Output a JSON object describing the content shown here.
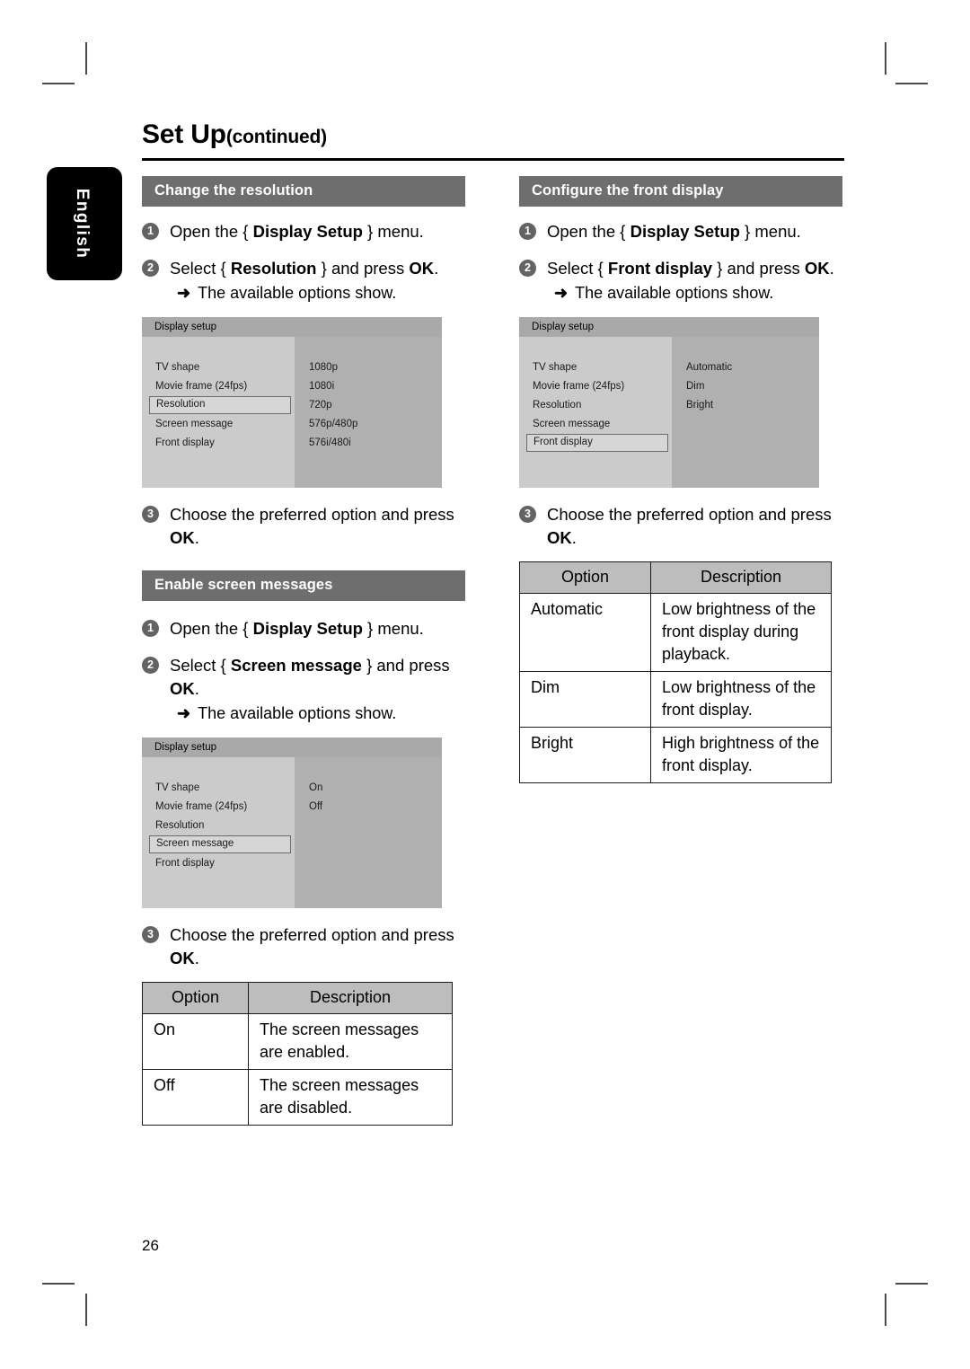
{
  "page": {
    "title_main": "Set Up",
    "title_suffix": "(continued)",
    "language_tab": "English",
    "page_number": "26"
  },
  "sections": {
    "change_resolution": {
      "heading": "Change the resolution",
      "steps": [
        {
          "num": "1",
          "pre": "Open the { ",
          "bold": "Display Setup",
          "post": " } menu."
        },
        {
          "num": "2",
          "pre": "Select { ",
          "bold": "Resolution",
          "post": " } and press ",
          "bold2": "OK",
          "post2": "."
        }
      ],
      "substep": "The available options show.",
      "step3_pre": "Choose the preferred option and press ",
      "step3_bold": "OK",
      "step3_post": ".",
      "osd": {
        "header": "Display setup",
        "items": [
          "TV shape",
          "Movie frame (24fps)",
          "Resolution",
          "Screen message",
          "Front display"
        ],
        "selected_index": 2,
        "values": [
          "1080p",
          "1080i",
          "720p",
          "576p/480p",
          "576i/480i"
        ]
      }
    },
    "enable_screen_messages": {
      "heading": "Enable screen messages",
      "steps": [
        {
          "num": "1",
          "pre": "Open the { ",
          "bold": "Display Setup",
          "post": " } menu."
        },
        {
          "num": "2",
          "pre": "Select { ",
          "bold": "Screen message",
          "post": " } and press ",
          "bold2": "OK",
          "post2": "."
        }
      ],
      "substep": "The available options show.",
      "step3_pre": "Choose the preferred option and press ",
      "step3_bold": "OK",
      "step3_post": ".",
      "osd": {
        "header": "Display setup",
        "items": [
          "TV shape",
          "Movie frame (24fps)",
          "Resolution",
          "Screen message",
          "Front display"
        ],
        "selected_index": 3,
        "values": [
          "On",
          "Off"
        ]
      },
      "table": {
        "col_option": "Option",
        "col_description": "Description",
        "rows": [
          {
            "option": "On",
            "description": "The screen messages are enabled."
          },
          {
            "option": "Off",
            "description": "The screen messages are disabled."
          }
        ]
      }
    },
    "configure_front_display": {
      "heading": "Configure the front display",
      "steps": [
        {
          "num": "1",
          "pre": "Open the { ",
          "bold": "Display Setup",
          "post": " } menu."
        },
        {
          "num": "2",
          "pre": "Select { ",
          "bold": "Front display",
          "post": " } and press ",
          "bold2": "OK",
          "post2": "."
        }
      ],
      "substep": "The available options show.",
      "step3_pre": "Choose the preferred option and press ",
      "step3_bold": "OK",
      "step3_post": ".",
      "osd": {
        "header": "Display setup",
        "items": [
          "TV shape",
          "Movie frame (24fps)",
          "Resolution",
          "Screen message",
          "Front display"
        ],
        "selected_index": 4,
        "values": [
          "Automatic",
          "Dim",
          "Bright"
        ]
      },
      "table": {
        "col_option": "Option",
        "col_description": "Description",
        "rows": [
          {
            "option": "Automatic",
            "description": "Low brightness of the front display during playback."
          },
          {
            "option": "Dim",
            "description": "Low brightness of the front display."
          },
          {
            "option": "Bright",
            "description": "High brightness of the front display."
          }
        ]
      }
    }
  },
  "glyphs": {
    "arrow": "➜"
  },
  "colors": {
    "heading_bar": "#6e6e6e",
    "step_bullet": "#636363",
    "osd_header": "#a9a9a9",
    "osd_left": "#cbcbcb",
    "osd_right": "#b0b0b0",
    "table_header": "#bdbdbd"
  }
}
